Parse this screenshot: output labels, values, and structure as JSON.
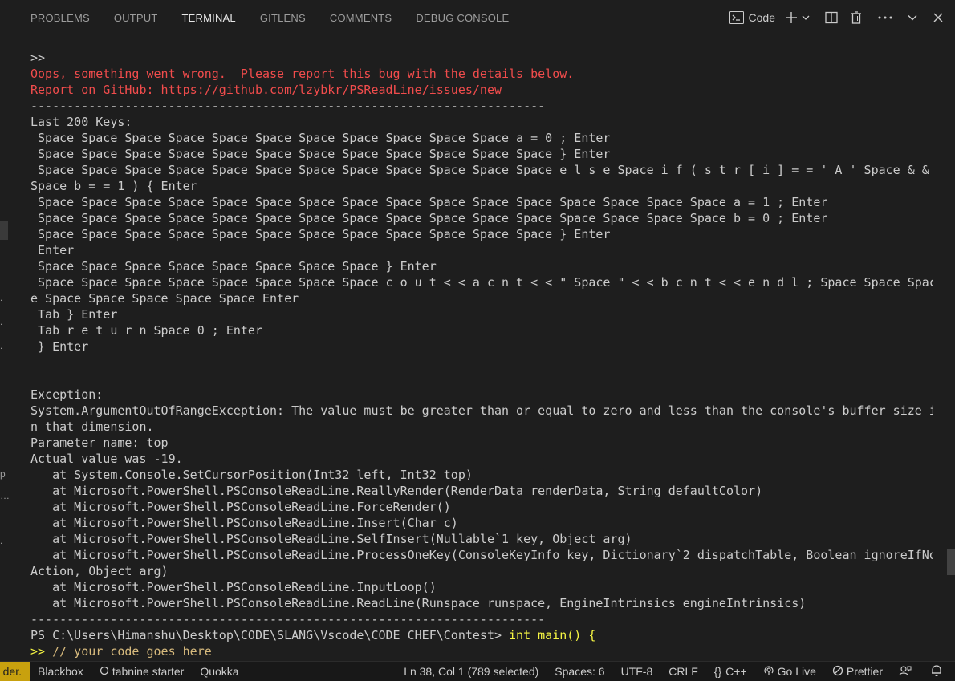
{
  "panel": {
    "tabs": [
      "PROBLEMS",
      "OUTPUT",
      "TERMINAL",
      "GITLENS",
      "COMMENTS",
      "DEBUG CONSOLE"
    ],
    "active_tab": "TERMINAL",
    "terminal_name": "Code"
  },
  "terminal": {
    "lines": [
      ">>",
      "Oops, something went wrong.  Please report this bug with the details below.",
      "Report on GitHub: https://github.com/lzybkr/PSReadLine/issues/new",
      "-----------------------------------------------------------------------",
      "Last 200 Keys:",
      " Space Space Space Space Space Space Space Space Space Space Space a = 0 ; Enter",
      " Space Space Space Space Space Space Space Space Space Space Space Space } Enter",
      " Space Space Space Space Space Space Space Space Space Space Space Space e l s e Space i f ( s t r [ i ] = = ' A ' Space & &",
      "Space b = = 1 ) { Enter",
      " Space Space Space Space Space Space Space Space Space Space Space Space Space Space Space Space a = 1 ; Enter",
      " Space Space Space Space Space Space Space Space Space Space Space Space Space Space Space Space b = 0 ; Enter",
      " Space Space Space Space Space Space Space Space Space Space Space Space } Enter",
      " Enter",
      " Space Space Space Space Space Space Space Space } Enter",
      " Space Space Space Space Space Space Space Space c o u t < < a c n t < < \" Space \" < < b c n t < < e n d l ; Space Space Spac",
      "e Space Space Space Space Space Enter",
      " Tab } Enter",
      " Tab r e t u r n Space 0 ; Enter",
      " } Enter",
      "",
      "",
      "Exception:",
      "System.ArgumentOutOfRangeException: The value must be greater than or equal to zero and less than the console's buffer size i",
      "n that dimension.",
      "Parameter name: top",
      "Actual value was -19.",
      "   at System.Console.SetCursorPosition(Int32 left, Int32 top)",
      "   at Microsoft.PowerShell.PSConsoleReadLine.ReallyRender(RenderData renderData, String defaultColor)",
      "   at Microsoft.PowerShell.PSConsoleReadLine.ForceRender()",
      "   at Microsoft.PowerShell.PSConsoleReadLine.Insert(Char c)",
      "   at Microsoft.PowerShell.PSConsoleReadLine.SelfInsert(Nullable`1 key, Object arg)",
      "   at Microsoft.PowerShell.PSConsoleReadLine.ProcessOneKey(ConsoleKeyInfo key, Dictionary`2 dispatchTable, Boolean ignoreIfNo",
      "Action, Object arg)",
      "   at Microsoft.PowerShell.PSConsoleReadLine.InputLoop()",
      "   at Microsoft.PowerShell.PSConsoleReadLine.ReadLine(Runspace runspace, EngineIntrinsics engineIntrinsics)",
      "-----------------------------------------------------------------------"
    ],
    "error_line_indexes": [
      1,
      2
    ],
    "prompt_path": "PS C:\\Users\\Himanshu\\Desktop\\CODE\\SLANG\\Vscode\\CODE_CHEF\\Contest>",
    "prompt_input_keyword": "int",
    "prompt_input_rest": " main() {",
    "continuation_prefix": ">>",
    "continuation_text": " // your code goes here"
  },
  "gutter_marks": [
    ".",
    ".",
    ".",
    "p",
    "…",
    "."
  ],
  "statusbar": {
    "remote_label": "der.",
    "left_items": [
      "Blackbox",
      "tabnine starter",
      "Quokka"
    ],
    "position": "Ln 38, Col 1 (789 selected)",
    "spaces": "Spaces: 6",
    "encoding": "UTF-8",
    "eol": "CRLF",
    "language": "C++",
    "go_live": "Go Live",
    "prettier": "Prettier"
  },
  "colors": {
    "background": "#1e1e1e",
    "error_text": "#f14c4c",
    "prompt_text": "#f5f543",
    "keyword": "#3b8eea",
    "comment": "#d7ba7d",
    "remote_badge": "#c8a10e"
  },
  "icons": [
    "terminal-icon",
    "plus-icon",
    "chevron-down-icon",
    "split-icon",
    "trash-icon",
    "more-icon",
    "chevron-down-icon",
    "close-icon",
    "circle-icon",
    "braces-icon",
    "broadcast-icon",
    "prohibit-icon",
    "feedback-icon",
    "bell-icon"
  ]
}
